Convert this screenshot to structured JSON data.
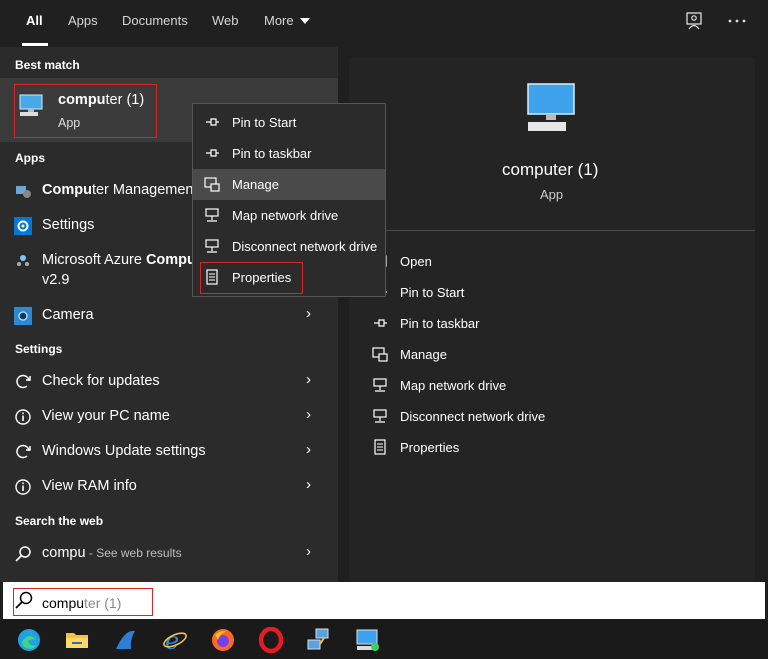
{
  "tabs": [
    {
      "label": "All",
      "active": true
    },
    {
      "label": "Apps"
    },
    {
      "label": "Documents"
    },
    {
      "label": "Web"
    },
    {
      "label": "More"
    }
  ],
  "top_icons": [
    "feedback-icon",
    "more-options-icon"
  ],
  "best_match": {
    "heading": "Best match",
    "title_bold": "compu",
    "title_rest": "ter (1)",
    "subtitle": "App"
  },
  "apps": {
    "heading": "Apps",
    "items": [
      {
        "bold": "Compu",
        "rest": "ter Management",
        "icon": "computer-management-icon"
      },
      {
        "bold": "",
        "rest": "Settings",
        "icon": "settings-gear-icon"
      },
      {
        "bold": "",
        "rest": "Microsoft Azure ",
        "bold2": "Compu",
        "line2": "v2.9",
        "icon": "azure-icon"
      },
      {
        "bold": "",
        "rest": "Camera",
        "icon": "camera-icon"
      }
    ]
  },
  "settings": {
    "heading": "Settings",
    "items": [
      {
        "label": "Check for updates",
        "icon": "refresh-icon"
      },
      {
        "label": "View your PC name",
        "icon": "info-icon"
      },
      {
        "label": "Windows Update settings",
        "icon": "refresh-icon"
      },
      {
        "label": "View RAM info",
        "icon": "info-icon"
      }
    ]
  },
  "web": {
    "heading": "Search the web",
    "query": "compu",
    "suffix": " - See web results"
  },
  "context_menu": [
    {
      "label": "Pin to Start",
      "icon": "pin-icon"
    },
    {
      "label": "Pin to taskbar",
      "icon": "pin-icon"
    },
    {
      "label": "Manage",
      "icon": "manage-icon"
    },
    {
      "label": "Map network drive",
      "icon": "network-drive-icon"
    },
    {
      "label": "Disconnect network drive",
      "icon": "network-drive-icon"
    },
    {
      "label": "Properties",
      "icon": "properties-icon"
    }
  ],
  "preview": {
    "title": "computer (1)",
    "subtitle": "App",
    "actions": [
      {
        "label": "Open",
        "icon": "open-icon"
      },
      {
        "label": "Pin to Start",
        "icon": "pin-icon"
      },
      {
        "label": "Pin to taskbar",
        "icon": "pin-icon"
      },
      {
        "label": "Manage",
        "icon": "manage-icon"
      },
      {
        "label": "Map network drive",
        "icon": "network-drive-icon"
      },
      {
        "label": "Disconnect network drive",
        "icon": "network-drive-icon"
      },
      {
        "label": "Properties",
        "icon": "properties-icon"
      }
    ]
  },
  "search": {
    "typed": "compu",
    "ghost": "ter (1)"
  },
  "taskbar": [
    "edge-icon",
    "file-explorer-icon",
    "shark-app-icon",
    "internet-explorer-icon",
    "firefox-icon",
    "opera-icon",
    "network-app-icon",
    "computer-app-icon"
  ],
  "colors": {
    "highlight": "#d9252c",
    "accent": "#0078d7"
  }
}
